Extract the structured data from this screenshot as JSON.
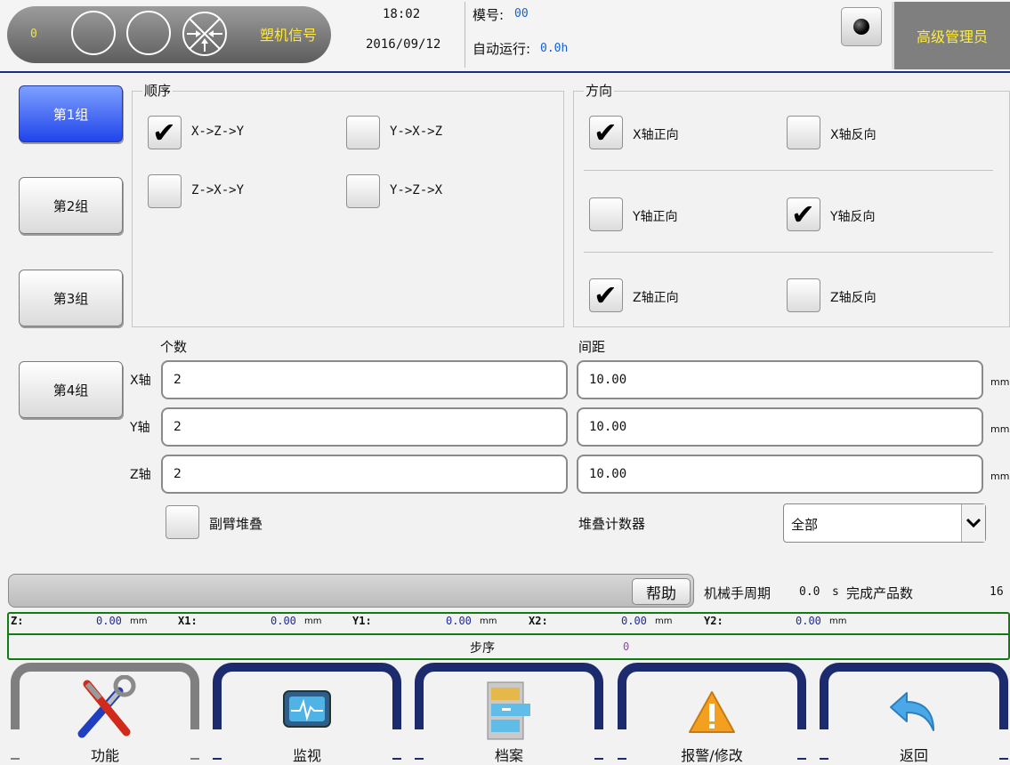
{
  "topbar": {
    "signal_count": "0",
    "signal_label": "塑机信号",
    "time": "18:02",
    "date": "2016/09/12",
    "model_label": "模号:",
    "model_value": "00",
    "auto_label": "自动运行:",
    "auto_value": "0.0h",
    "user_role": "高级管理员"
  },
  "groups": [
    "第1组",
    "第2组",
    "第3组",
    "第4组"
  ],
  "active_group": 0,
  "order": {
    "title": "顺序",
    "options": [
      {
        "label": "X->Z->Y",
        "checked": true
      },
      {
        "label": "Y->X->Z",
        "checked": false
      },
      {
        "label": "Z->X->Y",
        "checked": false
      },
      {
        "label": "Y->Z->X",
        "checked": false
      }
    ]
  },
  "direction": {
    "title": "方向",
    "options": [
      {
        "label": "X轴正向",
        "checked": true
      },
      {
        "label": "X轴反向",
        "checked": false
      },
      {
        "label": "Y轴正向",
        "checked": false
      },
      {
        "label": "Y轴反向",
        "checked": true
      },
      {
        "label": "Z轴正向",
        "checked": true
      },
      {
        "label": "Z轴反向",
        "checked": false
      }
    ]
  },
  "count": {
    "title": "个数",
    "axes": [
      {
        "label": "X轴",
        "value": "2"
      },
      {
        "label": "Y轴",
        "value": "2"
      },
      {
        "label": "Z轴",
        "value": "2"
      }
    ]
  },
  "spacing": {
    "title": "间距",
    "unit": "mm",
    "values": [
      "10.00",
      "10.00",
      "10.00"
    ]
  },
  "sub_arm_stack": {
    "label": "副臂堆叠",
    "checked": false
  },
  "stack_counter": {
    "label": "堆叠计数器",
    "selected": "全部"
  },
  "status": {
    "help": "帮助",
    "cycle_label": "机械手周期",
    "cycle_value": "0.0",
    "cycle_unit": "s",
    "done_label": "完成产品数",
    "done_value": "16"
  },
  "coords": [
    {
      "label": "Z:",
      "value": "0.00",
      "unit": "mm"
    },
    {
      "label": "X1:",
      "value": "0.00",
      "unit": "mm"
    },
    {
      "label": "Y1:",
      "value": "0.00",
      "unit": "mm"
    },
    {
      "label": "X2:",
      "value": "0.00",
      "unit": "mm"
    },
    {
      "label": "Y2:",
      "value": "0.00",
      "unit": "mm"
    }
  ],
  "step": {
    "label": "步序",
    "value": "0"
  },
  "nav": [
    {
      "label": "功能",
      "icon": "tools-icon"
    },
    {
      "label": "监视",
      "icon": "monitor-icon"
    },
    {
      "label": "档案",
      "icon": "file-cabinet-icon"
    },
    {
      "label": "报警/修改",
      "icon": "warning-icon"
    },
    {
      "label": "返回",
      "icon": "back-arrow-icon"
    }
  ],
  "colors": {
    "accent_blue": "#2044ea",
    "nav_frame": "#1c2a6e",
    "status_green": "#0f7d0f",
    "signal_yellow": "#ffe93b",
    "value_blue": "#1560d6"
  }
}
